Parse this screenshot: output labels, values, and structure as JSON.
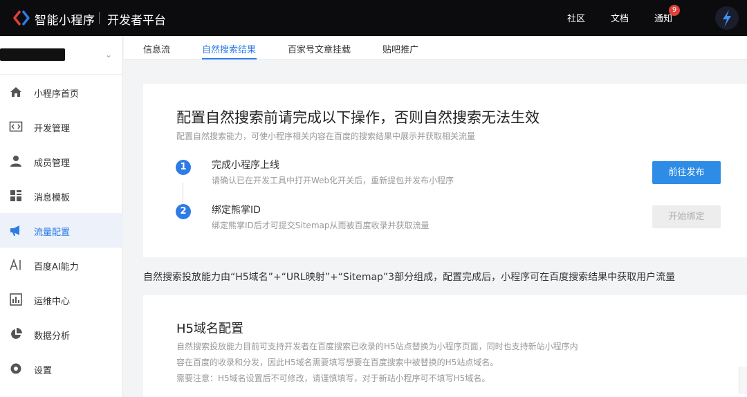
{
  "header": {
    "brand": "智能小程序",
    "platform": "开发者平台",
    "links": [
      "社区",
      "文档",
      "通知"
    ],
    "notification_count": "9"
  },
  "sidebar": {
    "items": [
      {
        "label": "小程序首页",
        "icon": "home-icon",
        "active": false
      },
      {
        "label": "开发管理",
        "icon": "code-icon",
        "active": false
      },
      {
        "label": "成员管理",
        "icon": "user-icon",
        "active": false
      },
      {
        "label": "消息模板",
        "icon": "template-icon",
        "active": false
      },
      {
        "label": "流量配置",
        "icon": "megaphone-icon",
        "active": true
      },
      {
        "label": "百度AI能力",
        "icon": "ai-icon",
        "active": false
      },
      {
        "label": "运维中心",
        "icon": "bar-chart-icon",
        "active": false
      },
      {
        "label": "数据分析",
        "icon": "pie-chart-icon",
        "active": false
      },
      {
        "label": "设置",
        "icon": "gear-icon",
        "active": false
      }
    ]
  },
  "tabs": [
    {
      "label": "信息流",
      "active": false
    },
    {
      "label": "自然搜索结果",
      "active": true
    },
    {
      "label": "百家号文章挂载",
      "active": false
    },
    {
      "label": "贴吧推广",
      "active": false
    }
  ],
  "setup": {
    "title": "配置自然搜索前请完成以下操作，否则自然搜索无法生效",
    "subtitle": "配置自然搜索能力，可使小程序相关内容在百度的搜索结果中展示并获取相关流量",
    "steps": [
      {
        "number": "1",
        "title": "完成小程序上线",
        "desc": "请确认已在开发工具中打开Web化开关后，重新提包并发布小程序",
        "button": "前往发布"
      },
      {
        "number": "2",
        "title": "绑定熊掌ID",
        "desc": "绑定熊掌ID后才可提交Sitemap从而被百度收录并获取流量",
        "button": "开始绑定"
      }
    ]
  },
  "notice": "自然搜索投放能力由“H5域名”+“URL映射”+“Sitemap”3部分组成，配置完成后，小程序可在百度搜索结果中获取用户流量",
  "h5": {
    "title": "H5域名配置",
    "lines": [
      "自然搜索投放能力目前可支持开发者在百度搜索已收录的H5站点替换为小程序页面，同时也支持新站小程序内",
      "容在百度的收录和分发，因此H5域名需要填写想要在百度搜索中被替换的H5站点域名。",
      "需要注意：H5域名设置后不可修改，请谨慎填写，对于新站小程序可不填写H5域名。"
    ]
  },
  "colors": {
    "accent": "#2e7be6",
    "topbar": "#0c0c0e",
    "badge": "#e0403a"
  }
}
